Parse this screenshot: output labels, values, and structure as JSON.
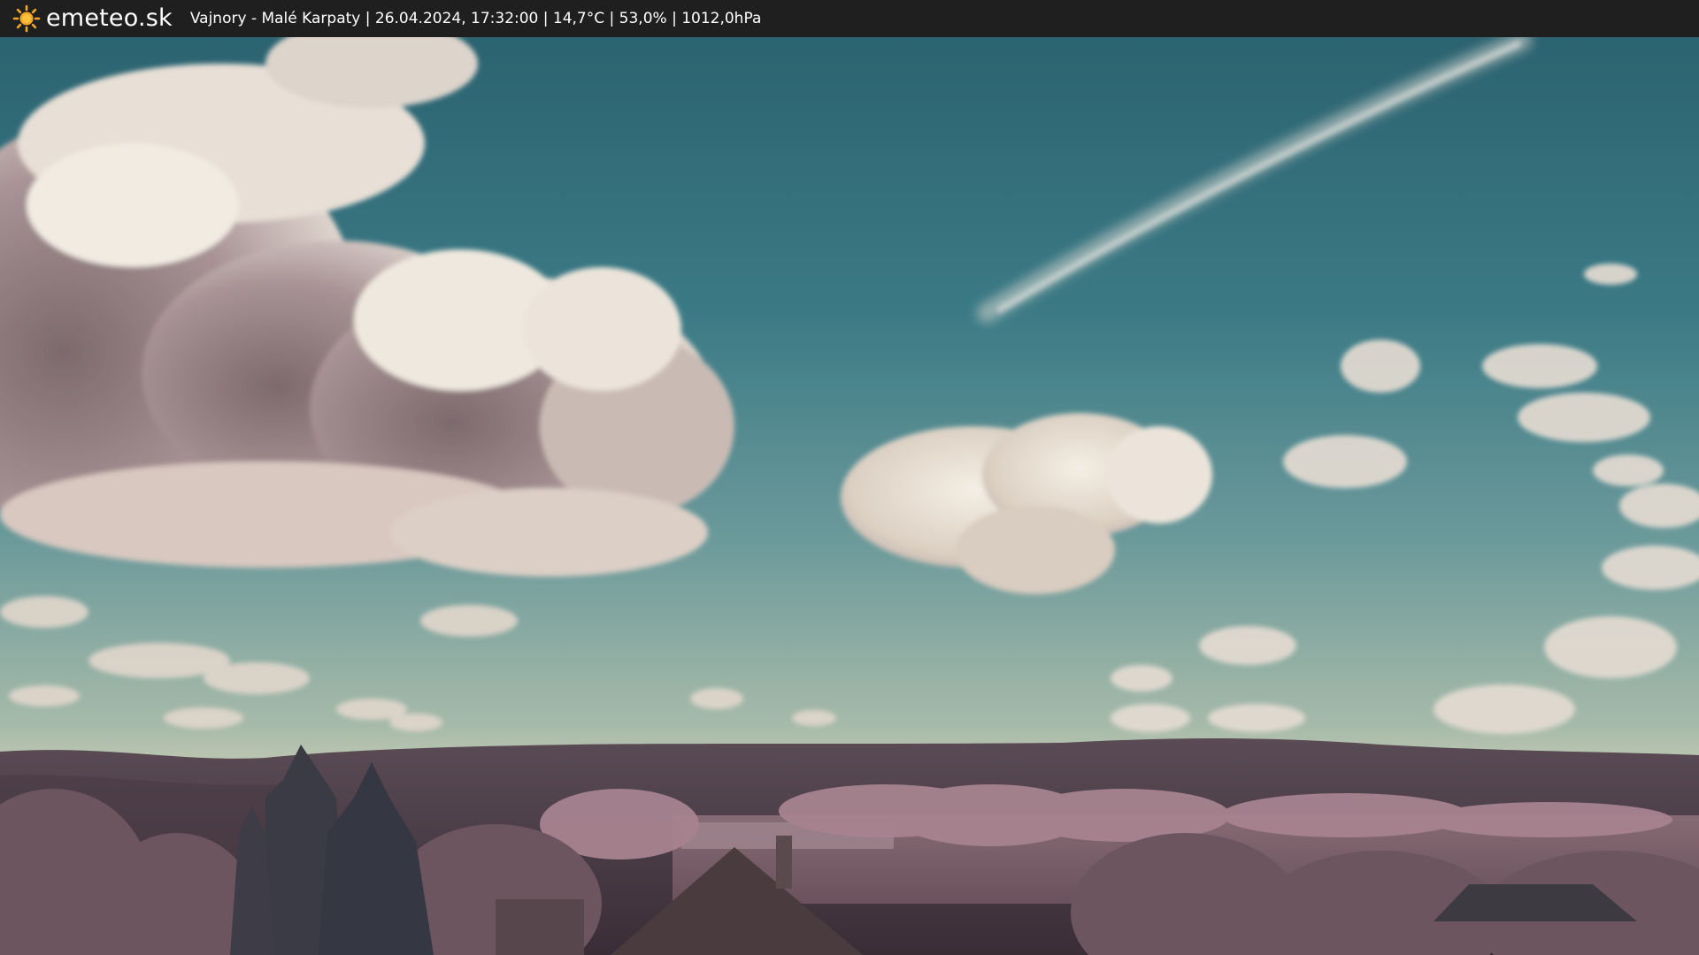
{
  "header": {
    "logo_icon": "sun-icon",
    "brand": "emeteo.sk",
    "caption": "Vajnory - Malé Karpaty | 26.04.2024, 17:32:00 | 14,7°C | 53,0% | 1012,0hPa"
  },
  "colors": {
    "bar_background": "#1f1f1f",
    "sun": "#f5a623",
    "sky_top": "#2f6a78",
    "sky_horizon": "#c9cdb6",
    "hills": "#4a3a44",
    "foliage": "#a88592"
  }
}
